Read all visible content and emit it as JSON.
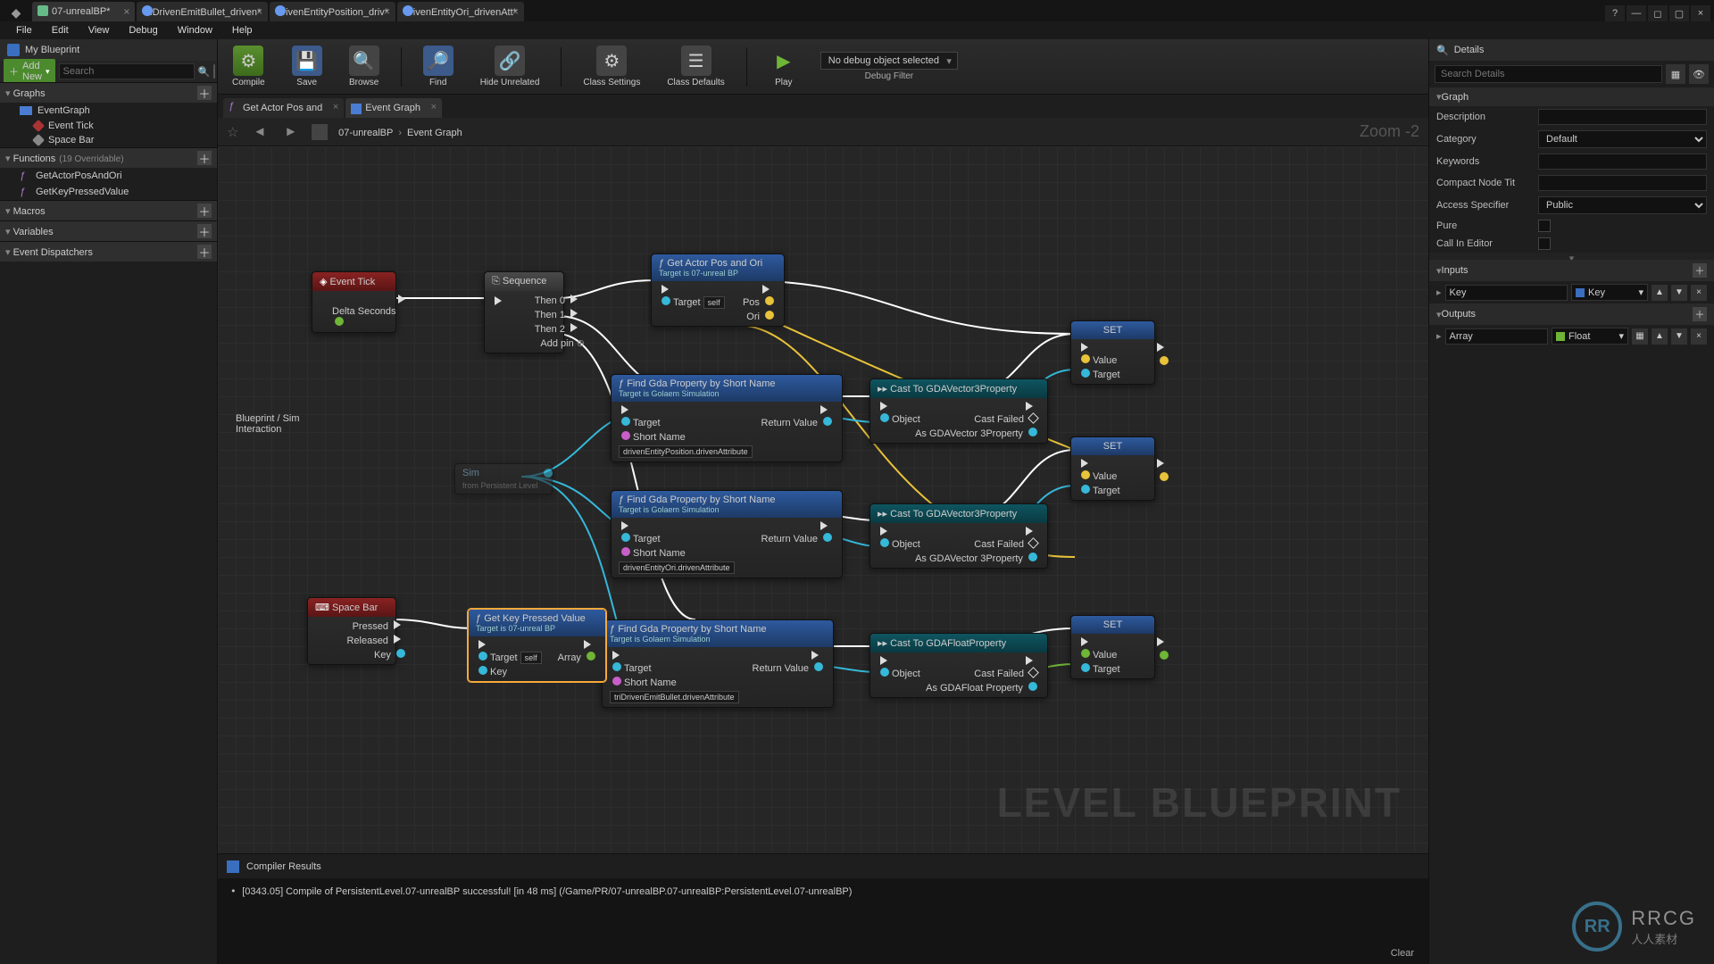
{
  "title_tabs": [
    {
      "label": "07-unrealBP*",
      "active": true,
      "nb": false
    },
    {
      "label": "triDrivenEmitBullet_driven*",
      "nb": true
    },
    {
      "label": "drivenEntityPosition_driv*",
      "nb": true
    },
    {
      "label": "drivenEntityOri_drivenAtt*",
      "nb": true
    }
  ],
  "menubar": [
    "File",
    "Edit",
    "View",
    "Debug",
    "Window",
    "Help"
  ],
  "left": {
    "panel": "My Blueprint",
    "add": "Add New",
    "search_ph": "Search",
    "sections": {
      "graphs": "Graphs",
      "functions": "Functions",
      "func_count": "(19 Overridable)",
      "macros": "Macros",
      "variables": "Variables",
      "dispatch": "Event Dispatchers"
    },
    "graph_items": {
      "eg": "EventGraph",
      "tick": "Event Tick",
      "space": "Space Bar"
    },
    "fns": [
      "GetActorPosAndOri",
      "GetKeyPressedValue"
    ]
  },
  "toolbar": {
    "compile": "Compile",
    "save": "Save",
    "browse": "Browse",
    "find": "Find",
    "hide": "Hide Unrelated",
    "cs": "Class Settings",
    "cd": "Class Defaults",
    "play": "Play",
    "dbg": "No debug object selected",
    "dbgf": "Debug Filter"
  },
  "gtabs": [
    {
      "label": "Get Actor Pos and",
      "kind": "fn"
    },
    {
      "label": "Event Graph",
      "kind": "eg",
      "active": true
    }
  ],
  "crumb": {
    "a": "07-unrealBP",
    "b": "Event Graph",
    "zoom": "Zoom -2"
  },
  "nodes": {
    "tick": {
      "title": "Event Tick",
      "delta": "Delta Seconds"
    },
    "seq": {
      "title": "Sequence",
      "p": [
        "Then 0",
        "Then 1",
        "Then 2"
      ],
      "add": "Add pin"
    },
    "getpos": {
      "title": "Get Actor Pos and Ori",
      "sub": "Target is 07-unreal BP",
      "tgt": "Target",
      "self": "self",
      "pos": "Pos",
      "ori": "Ori"
    },
    "find": {
      "title": "Find Gda Property by Short Name",
      "sub": "Target is Golaem Simulation",
      "tgt": "Target",
      "sn": "Short Name",
      "rv": "Return Value"
    },
    "find_vals": [
      "drivenEntityPosition.drivenAttribute",
      "drivenEntityOri.drivenAttribute",
      "triDrivenEmitBullet.drivenAttribute"
    ],
    "cast3": {
      "title": "Cast To GDAVector3Property",
      "obj": "Object",
      "fail": "Cast Failed",
      "as": "As GDAVector 3Property"
    },
    "castf": {
      "title": "Cast To GDAFloatProperty",
      "obj": "Object",
      "fail": "Cast Failed",
      "as": "As GDAFloat Property"
    },
    "set": {
      "title": "SET",
      "val": "Value",
      "tgt": "Target"
    },
    "space": {
      "title": "Space Bar",
      "pressed": "Pressed",
      "released": "Released",
      "key": "Key"
    },
    "getkey": {
      "title": "Get Key Pressed Value",
      "sub": "Target is 07-unreal BP",
      "tgt": "Target",
      "self": "self",
      "key": "Key",
      "arr": "Array"
    },
    "sim": {
      "title": "Sim",
      "sub": "from Persistent Level"
    }
  },
  "right": {
    "panel": "Details",
    "search_ph": "Search Details",
    "graph": "Graph",
    "fields": {
      "desc": "Description",
      "cat": "Category",
      "cat_v": "Default",
      "kw": "Keywords",
      "cnt": "Compact Node Tit",
      "acc": "Access Specifier",
      "acc_v": "Public",
      "pure": "Pure",
      "cie": "Call In Editor"
    },
    "inputs": "Inputs",
    "outputs": "Outputs",
    "in": {
      "name": "Key",
      "type": "Key"
    },
    "out": {
      "name": "Array",
      "type": "Float"
    }
  },
  "overlay": {
    "line1": "Blueprint / Sim",
    "line2": "Interaction",
    "wm": "LEVEL BLUEPRINT"
  },
  "comp": {
    "title": "Compiler Results",
    "log": "[0343.05] Compile of PersistentLevel.07-unrealBP successful! [in 48 ms] (/Game/PR/07-unrealBP.07-unrealBP:PersistentLevel.07-unrealBP)",
    "clear": "Clear"
  },
  "rrcg": {
    "c": "RR",
    "t1": "RRCG",
    "t2": "人人素材"
  }
}
